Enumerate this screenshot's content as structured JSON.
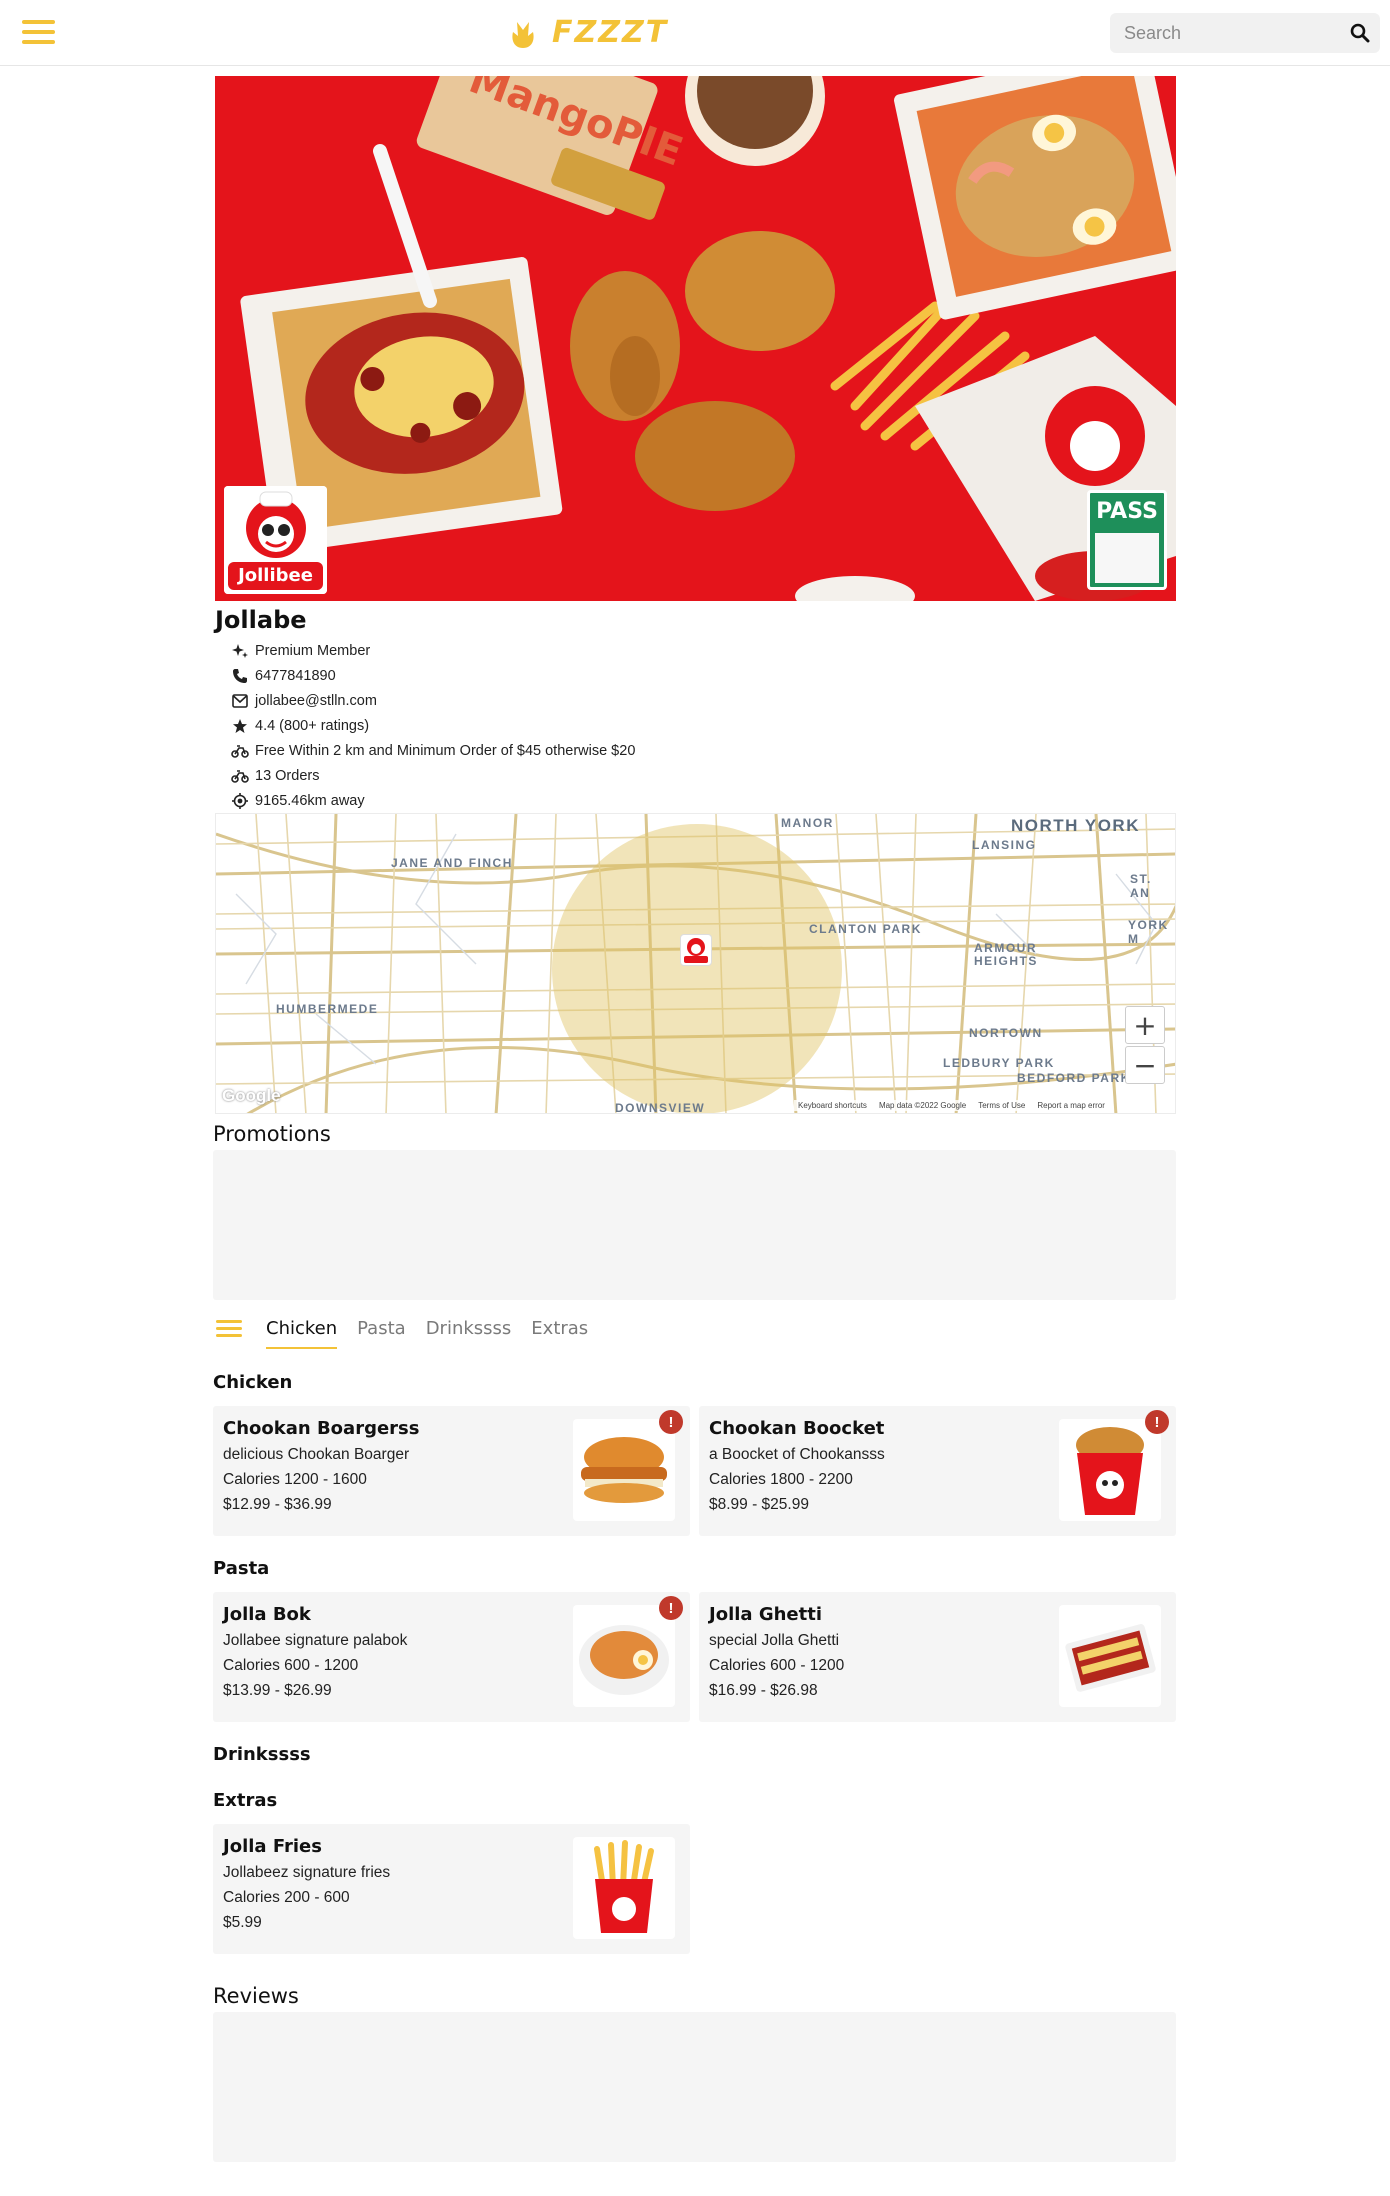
{
  "header": {
    "logo_text": "FZZZT",
    "search": {
      "placeholder": "Search"
    }
  },
  "store": {
    "name": "Jollabe",
    "logo_text": "Jollibee",
    "pass_text": "PASS",
    "info": [
      {
        "icon": "sparkle-icon",
        "text": "Premium Member"
      },
      {
        "icon": "phone-icon",
        "text": "6477841890"
      },
      {
        "icon": "mail-icon",
        "text": "jollabee@stlln.com"
      },
      {
        "icon": "star-icon",
        "text": "4.4 (800+ ratings)"
      },
      {
        "icon": "delivery-icon",
        "text": "Free Within 2 km and Minimum Order of $45 otherwise $20"
      },
      {
        "icon": "orders-icon",
        "text": "13 Orders"
      },
      {
        "icon": "location-icon",
        "text": "9165.46km away"
      }
    ]
  },
  "map": {
    "labels": [
      "NORTH YORK",
      "LANSING",
      "MANOR",
      "JANE AND FINCH",
      "CLANTON PARK",
      "ARMOUR HEIGHTS",
      "HUMBERMEDE",
      "NORTOWN",
      "LEDBURY PARK",
      "BEDFORD PARK",
      "DOWNSVIEW",
      "YORK M",
      "ST. AN"
    ],
    "zoom_in": "+",
    "zoom_out": "−",
    "google": "Google",
    "attribution": [
      "Keyboard shortcuts",
      "Map data ©2022 Google",
      "Terms of Use",
      "Report a map error"
    ]
  },
  "promotions": {
    "title": "Promotions"
  },
  "tabs": [
    {
      "label": "Chicken",
      "active": true
    },
    {
      "label": "Pasta",
      "active": false
    },
    {
      "label": "Drinkssss",
      "active": false
    },
    {
      "label": "Extras",
      "active": false
    }
  ],
  "menu": {
    "chicken": {
      "title": "Chicken",
      "items": [
        {
          "name": "Chookan Boargerss",
          "desc": "delicious Chookan Boarger",
          "calories": "Calories 1200 - 1600",
          "price": "$12.99 - $36.99",
          "alert": "!"
        },
        {
          "name": "Chookan Boocket",
          "desc": "a Boocket of Chookansss",
          "calories": "Calories 1800 - 2200",
          "price": "$8.99 - $25.99",
          "alert": "!"
        }
      ]
    },
    "pasta": {
      "title": "Pasta",
      "items": [
        {
          "name": "Jolla Bok",
          "desc": "Jollabee signature palabok",
          "calories": "Calories 600 - 1200",
          "price": "$13.99 - $26.99",
          "alert": "!"
        },
        {
          "name": "Jolla Ghetti",
          "desc": "special Jolla Ghetti",
          "calories": "Calories 600 - 1200",
          "price": "$16.99 - $26.98"
        }
      ]
    },
    "drinks": {
      "title": "Drinkssss"
    },
    "extras": {
      "title": "Extras",
      "items": [
        {
          "name": "Jolla Fries",
          "desc": "Jollabeez signature fries",
          "calories": "Calories 200 - 600",
          "price": "$5.99"
        }
      ]
    }
  },
  "reviews": {
    "title": "Reviews"
  },
  "colors": {
    "accent": "#f3c237",
    "brand_red": "#e4141b",
    "alert_red": "#c0392b",
    "panel": "#f5f5f5"
  }
}
